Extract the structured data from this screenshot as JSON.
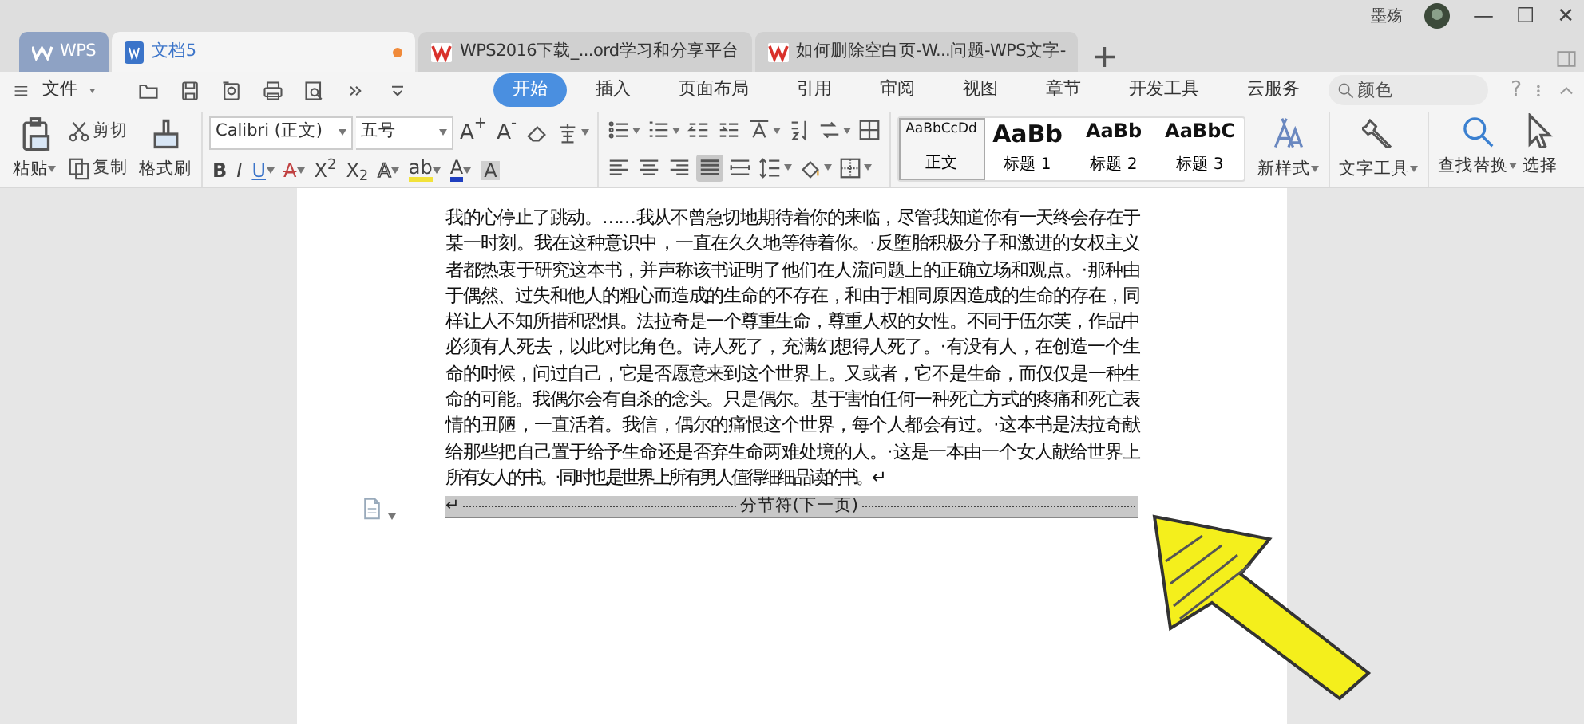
{
  "title_bar": {
    "tabs": [
      {
        "label": "WPS",
        "kind": "home",
        "selected": false,
        "modified": false
      },
      {
        "label": "文档5",
        "kind": "doc",
        "selected": true,
        "modified": true
      },
      {
        "label": "WPS2016下载_...ord学习和分享平台",
        "kind": "web",
        "selected": false,
        "modified": false
      },
      {
        "label": "如何删除空白页-W...问题-WPS文字-",
        "kind": "web",
        "selected": false,
        "modified": false
      }
    ],
    "new_tab": "+",
    "user": "墨殇",
    "window_controls": [
      "—",
      "☐",
      "✕"
    ]
  },
  "menu_bar": {
    "file": "文件",
    "ribbon_tabs": [
      {
        "label": "开始",
        "selected": true
      },
      {
        "label": "插入",
        "selected": false
      },
      {
        "label": "页面布局",
        "selected": false
      },
      {
        "label": "引用",
        "selected": false
      },
      {
        "label": "审阅",
        "selected": false
      },
      {
        "label": "视图",
        "selected": false
      },
      {
        "label": "章节",
        "selected": false
      },
      {
        "label": "开发工具",
        "selected": false
      },
      {
        "label": "云服务",
        "selected": false
      }
    ],
    "search": {
      "placeholder": "颜色"
    },
    "help": "?"
  },
  "ribbon": {
    "clipboard": {
      "paste": "粘贴",
      "cut": "剪切",
      "copy": "复制",
      "format_painter": "格式刷"
    },
    "font": {
      "name": "Calibri (正文)",
      "size": "五号",
      "size_buttons": [
        "A$^{+}$",
        "A$^{-}$"
      ],
      "format_buttons": [
        {
          "label": "B",
          "kind": "bold",
          "dropdown": false
        },
        {
          "label": "I",
          "kind": "italic",
          "dropdown": false
        },
        {
          "label": "U",
          "kind": "underline",
          "dropdown": true
        },
        {
          "label": "A",
          "kind": "strike",
          "dropdown": true
        },
        {
          "label": "X$^{2}$",
          "kind": "plain",
          "dropdown": false
        },
        {
          "label": "X$_{2}$",
          "kind": "plain",
          "dropdown": false
        },
        {
          "label": "A",
          "kind": "outline",
          "dropdown": true
        },
        {
          "label": "ab",
          "kind": "highlight",
          "dropdown": true
        },
        {
          "label": "A",
          "kind": "color",
          "dropdown": true
        },
        {
          "label": "A",
          "kind": "shade",
          "dropdown": false
        }
      ]
    },
    "paragraph": {
      "row_1": [
        {
          "kind": "bullets",
          "dropdown": true
        },
        {
          "kind": "numbering",
          "dropdown": true
        },
        {
          "kind": "outdent",
          "dropdown": false
        },
        {
          "kind": "indent",
          "dropdown": false
        },
        {
          "kind": "direction",
          "dropdown": true
        },
        {
          "kind": "sort",
          "dropdown": false
        },
        {
          "kind": "spacing",
          "dropdown": true
        },
        {
          "kind": "table",
          "dropdown": false
        }
      ],
      "alignment": [
        {
          "kind": "left",
          "selected": false
        },
        {
          "kind": "center",
          "selected": false
        },
        {
          "kind": "right",
          "selected": false
        },
        {
          "kind": "justify",
          "selected": true
        },
        {
          "kind": "distributed",
          "selected": false
        }
      ],
      "row_2": [
        {
          "kind": "linespacing",
          "dropdown": true
        },
        {
          "kind": "fill",
          "dropdown": true
        },
        {
          "kind": "borders",
          "dropdown": true
        }
      ]
    },
    "styles": [
      {
        "preview": "AaBbCcDd",
        "label": "正文",
        "selected": true
      },
      {
        "preview": "AaBb",
        "label": "标题 1",
        "selected": false
      },
      {
        "preview": "AaBb",
        "label": "标题 2",
        "selected": false
      },
      {
        "preview": "AaBbC",
        "label": "标题 3",
        "selected": false
      }
    ],
    "new_style": "新样式",
    "text_tools": "文字工具",
    "find_replace": "查找替换",
    "select": "选择"
  },
  "document": {
    "lines": [
      "我的心停止了跳动。……我从不曾急切地期待着你的来临，尽管我知道你有一天终会存在于",
      "某一时刻。我在这种意识中，一直在久久地等待着你。·反堕胎积极分子和激进的女权主义",
      "者都热衷于研究这本书，并声称该书证明了他们在人流问题上的正确立场和观点。·那种由",
      "于偶然、过失和他人的粗心而造成的生命的不存在，和由于相同原因造成的生命的存在，同",
      "样让人不知所措和恐惧。法拉奇是一个尊重生命，尊重人权的女性。不同于伍尔芙，作品中",
      "必须有人死去，以此对比角色。诗人死了，充满幻想得人死了。·有没有人，在创造一个生",
      "命的时候，问过自己，它是否愿意来到这个世界上。又或者，它不是生命，而仅仅是一种生",
      "命的可能。我偶尔会有自杀的念头。只是偶尔。基于害怕任何一种死亡方式的疼痛和死亡表",
      "情的丑陋，一直活着。我信，偶尔的痛恨这个世界，每个人都会有过。·这本书是法拉奇献",
      "给那些把自己置于给予生命还是否弃生命两难处境的人。·这是一本由一个女人献给世界上",
      "所有女人的书。·同时也是世界上所有男人值得细细品读的书。↵"
    ],
    "section_break": "分节符(下一页)",
    "break_mark": "↵"
  }
}
